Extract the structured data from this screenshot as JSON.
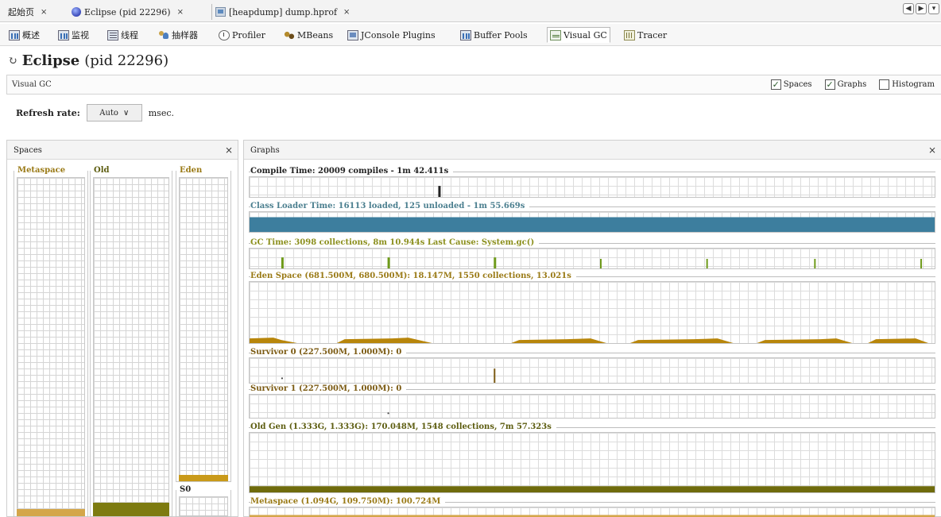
{
  "doc_tabs": [
    {
      "label": "起始页",
      "close": "×"
    },
    {
      "label": "Eclipse (pid 22296)",
      "close": "×"
    },
    {
      "label": "[heapdump] dump.hprof",
      "close": "×"
    }
  ],
  "window_controls": [
    "◀",
    "▶",
    "▾"
  ],
  "tool_tabs": [
    {
      "label": "概述",
      "icon": "chart-icon"
    },
    {
      "label": "监视",
      "icon": "monitor-icon"
    },
    {
      "label": "线程",
      "icon": "threads-icon"
    },
    {
      "label": "抽样器",
      "icon": "sampler-icon"
    },
    {
      "label": "Profiler",
      "icon": "profiler-icon"
    },
    {
      "label": "MBeans",
      "icon": "mbeans-icon"
    },
    {
      "label": "JConsole Plugins",
      "icon": "jconsole-icon"
    },
    {
      "label": "Buffer Pools",
      "icon": "buffer-icon"
    },
    {
      "label": "Visual GC",
      "icon": "visual-gc-icon"
    },
    {
      "label": "Tracer",
      "icon": "tracer-icon"
    }
  ],
  "title": {
    "app": "Eclipse",
    "pid": "(pid 22296)"
  },
  "visual_gc": {
    "label": "Visual GC",
    "options": [
      {
        "label": "Spaces",
        "checked": true
      },
      {
        "label": "Graphs",
        "checked": true
      },
      {
        "label": "Histogram",
        "checked": false
      }
    ]
  },
  "refresh": {
    "label": "Refresh rate:",
    "value": "Auto",
    "unit": "msec."
  },
  "spaces_panel": {
    "title": "Spaces",
    "close": "×",
    "spaces": [
      {
        "name": "Metaspace",
        "fill": 0.02,
        "color": "#d4a64a"
      },
      {
        "name": "Old",
        "fill": 0.04,
        "color": "#7d7b10"
      },
      {
        "name": "Eden",
        "fill": 0.02,
        "color": "#c99a1a"
      },
      {
        "name": "S0",
        "fill": 0.0,
        "color": "#c99a1a"
      }
    ]
  },
  "graphs_panel": {
    "title": "Graphs",
    "close": "×",
    "graphs": [
      {
        "id": "compile",
        "title": "Compile Time: 20009 compiles - 1m 42.411s"
      },
      {
        "id": "classloader",
        "title": "Class Loader Time: 16113 loaded, 125 unloaded - 1m 55.669s"
      },
      {
        "id": "gc",
        "title": "GC Time: 3098 collections, 8m 10.944s  Last Cause: System.gc()"
      },
      {
        "id": "eden",
        "title": "Eden Space (681.500M, 680.500M): 18.147M, 1550 collections, 13.021s"
      },
      {
        "id": "s0",
        "title": "Survivor 0 (227.500M, 1.000M): 0"
      },
      {
        "id": "s1",
        "title": "Survivor 1 (227.500M, 1.000M): 0"
      },
      {
        "id": "oldgen",
        "title": "Old Gen (1.333G, 1.333G): 170.048M, 1548 collections, 7m 57.323s"
      },
      {
        "id": "meta",
        "title": "Metaspace (1.094G, 109.750M): 100.724M"
      }
    ]
  }
}
